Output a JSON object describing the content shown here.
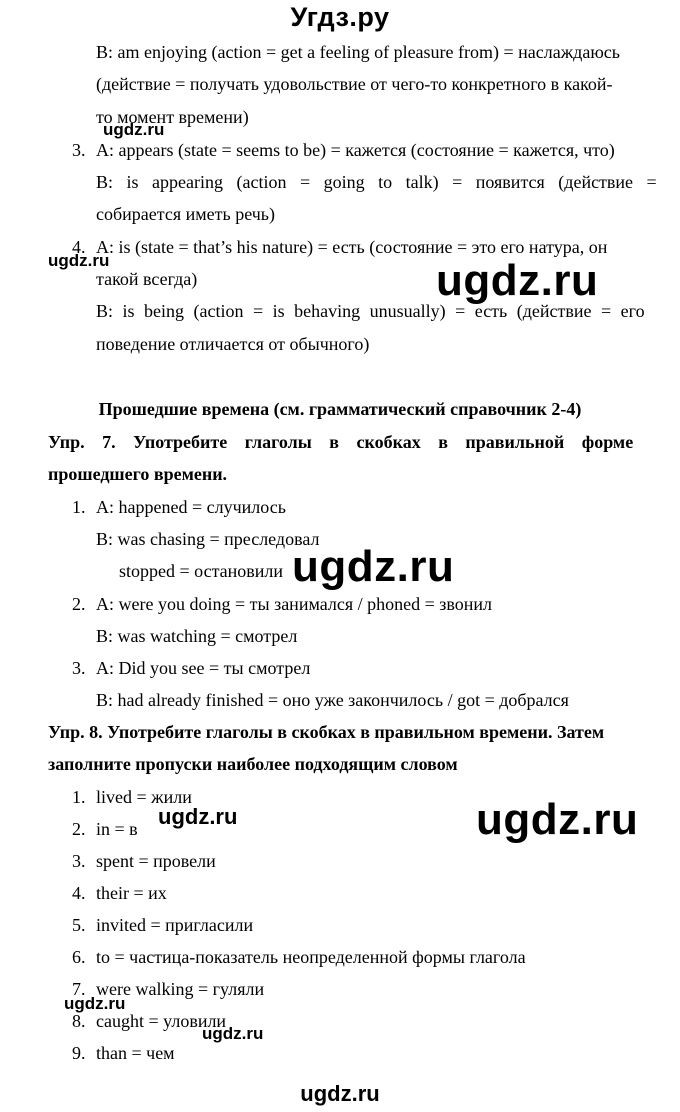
{
  "header": {
    "site_title": "Угдз.ру"
  },
  "watermark_text": "ugdz.ru",
  "continuation": {
    "item2B_line1": "B: am enjoying (action = get a feeling of pleasure from) = наслаждаюсь",
    "item2B_line2": "(действие = получать удовольствие от чего-то конкретного в какой-",
    "item2B_line3": "то момент времени)",
    "item3": {
      "num": "3.",
      "a": "A: appears (state = seems to be) = кажется (состояние = кажется, что)",
      "b_line1": "B: is appearing (action = going to talk) = появится (действие =",
      "b_line2": "собирается иметь речь)"
    },
    "item4": {
      "num": "4.",
      "a_line1": "A: is (state = that’s his nature) = есть (состояние = это его натура, он",
      "a_line2": "такой всегда)",
      "b_line1": "B: is being (action = is behaving unusually) = есть (действие = его",
      "b_line2": "поведение отличается от обычного)"
    }
  },
  "section_heading": "Прошедшие времена (см. грамматический справочник 2-4)",
  "exercise7": {
    "title_line1": "Упр. 7. Употребите глаголы в скобках в правильной форме",
    "title_line2": "прошедшего времени.",
    "items": [
      {
        "num": "1.",
        "a": "A: happened = случилось",
        "b": "B: was chasing = преследовал",
        "c": "stopped = остановили"
      },
      {
        "num": "2.",
        "a": "A: were you doing = ты занимался / phoned = звонил",
        "b": "B: was watching = смотрел"
      },
      {
        "num": "3.",
        "a": "A: Did you see = ты смотрел",
        "b": "B: had already finished = оно уже закончилось / got = добрался"
      }
    ]
  },
  "exercise8": {
    "title_line1": "Упр. 8. Употребите глаголы в скобках в правильном времени. Затем",
    "title_line2": "заполните пропуски наиболее подходящим словом",
    "items": [
      {
        "num": "1.",
        "text": "lived = жили"
      },
      {
        "num": "2.",
        "text": "in = в"
      },
      {
        "num": "3.",
        "text": "spent = провели"
      },
      {
        "num": "4.",
        "text": "their = их"
      },
      {
        "num": "5.",
        "text": "invited = пригласили"
      },
      {
        "num": "6.",
        "text": "to = частица-показатель неопределенной формы глагола"
      },
      {
        "num": "7.",
        "text": "were walking = гуляли"
      },
      {
        "num": "8.",
        "text": "caught = уловили"
      },
      {
        "num": "9.",
        "text": "than = чем"
      }
    ]
  }
}
